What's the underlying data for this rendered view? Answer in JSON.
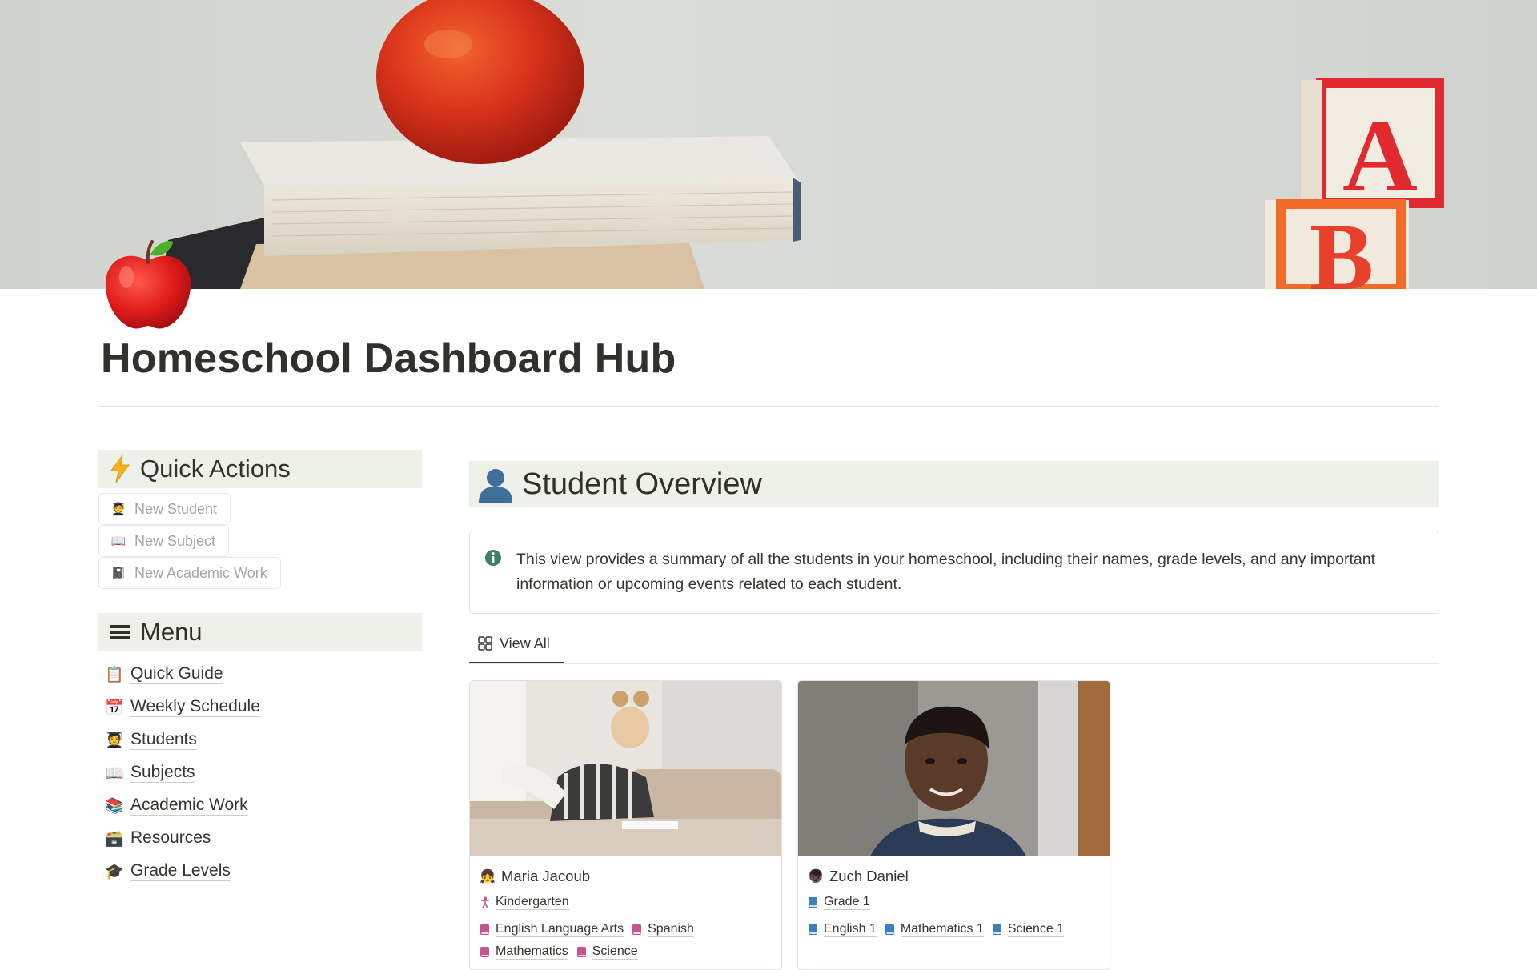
{
  "page": {
    "title": "Homeschool Dashboard Hub",
    "icon": "red-apple-icon"
  },
  "quick_actions": {
    "heading": "Quick Actions",
    "heading_icon": "lightning-icon",
    "buttons": [
      {
        "label": "New Student",
        "icon": "student-icon"
      },
      {
        "label": "New Subject",
        "icon": "open-book-icon"
      },
      {
        "label": "New Academic Work",
        "icon": "notebook-icon"
      }
    ]
  },
  "menu": {
    "heading": "Menu",
    "heading_icon": "hamburger-icon",
    "items": [
      {
        "label": "Quick Guide",
        "icon": "clipboard-icon"
      },
      {
        "label": "Weekly Schedule",
        "icon": "calendar-icon"
      },
      {
        "label": "Students",
        "icon": "student-icon"
      },
      {
        "label": "Subjects",
        "icon": "open-book-icon"
      },
      {
        "label": "Academic Work",
        "icon": "books-icon"
      },
      {
        "label": "Resources",
        "icon": "file-box-icon"
      },
      {
        "label": "Grade Levels",
        "icon": "graduation-cap-icon"
      }
    ]
  },
  "student_overview": {
    "heading": "Student Overview",
    "heading_icon": "person-silhouette-icon",
    "callout": "This view provides a summary of all the students in your homeschool, including their names, grade levels, and any important information or upcoming events related to each student.",
    "callout_icon": "info-icon",
    "tabs": [
      {
        "label": "View All",
        "icon": "gallery-icon",
        "active": true
      }
    ],
    "cards": [
      {
        "name": "Maria Jacoub",
        "avatar": "girl-face-icon",
        "grade": "Kindergarten",
        "grade_icon": "figure-icon",
        "grade_color": "#c4558e",
        "subjects": [
          "English Language Arts",
          "Spanish",
          "Mathematics",
          "Science"
        ],
        "subject_color": "#c4558e"
      },
      {
        "name": "Zuch Daniel",
        "avatar": "boy-face-icon",
        "grade": "Grade 1",
        "grade_icon": "book-icon",
        "grade_color": "#3c7fc0",
        "subjects": [
          "English 1",
          "Mathematics 1",
          "Science 1"
        ],
        "subject_color": "#3c7fc0"
      }
    ]
  }
}
